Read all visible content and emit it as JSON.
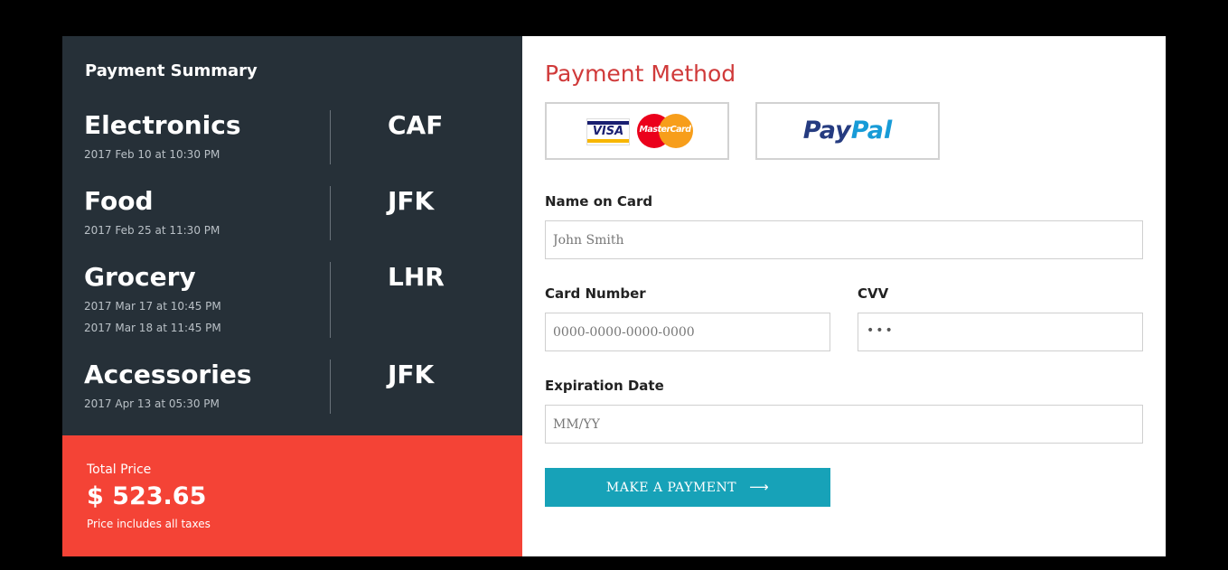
{
  "summary": {
    "title": "Payment Summary",
    "items": [
      {
        "name": "Electronics",
        "dates": [
          "2017 Feb 10 at 10:30 PM"
        ],
        "code": "CAF"
      },
      {
        "name": "Food",
        "dates": [
          "2017 Feb 25 at 11:30 PM"
        ],
        "code": "JFK"
      },
      {
        "name": "Grocery",
        "dates": [
          "2017 Mar 17 at 10:45 PM",
          "2017 Mar 18 at 11:45 PM"
        ],
        "code": "LHR"
      },
      {
        "name": "Accessories",
        "dates": [
          "2017 Apr 13 at 05:30 PM"
        ],
        "code": "JFK"
      }
    ],
    "total": {
      "label": "Total Price",
      "value": "$ 523.65",
      "note": "Price includes all taxes"
    }
  },
  "payment": {
    "title": "Payment Method",
    "options": {
      "visa_text": "VISA",
      "mastercard_text": "MasterCard",
      "paypal_part1": "Pay",
      "paypal_part2": "Pal"
    },
    "name_label": "Name on Card",
    "name_placeholder": "John Smith",
    "card_label": "Card Number",
    "card_placeholder": "0000-0000-0000-0000",
    "cvv_label": "CVV",
    "cvv_value": "•••",
    "exp_label": "Expiration Date",
    "exp_placeholder": "MM/YY",
    "submit_label": "MAKE A PAYMENT",
    "submit_icon": "arrow-right-icon"
  },
  "colors": {
    "summary_bg": "#263038",
    "total_bg": "#f44336",
    "accent_title": "#d03a3a",
    "button_bg": "#17a2b8"
  }
}
